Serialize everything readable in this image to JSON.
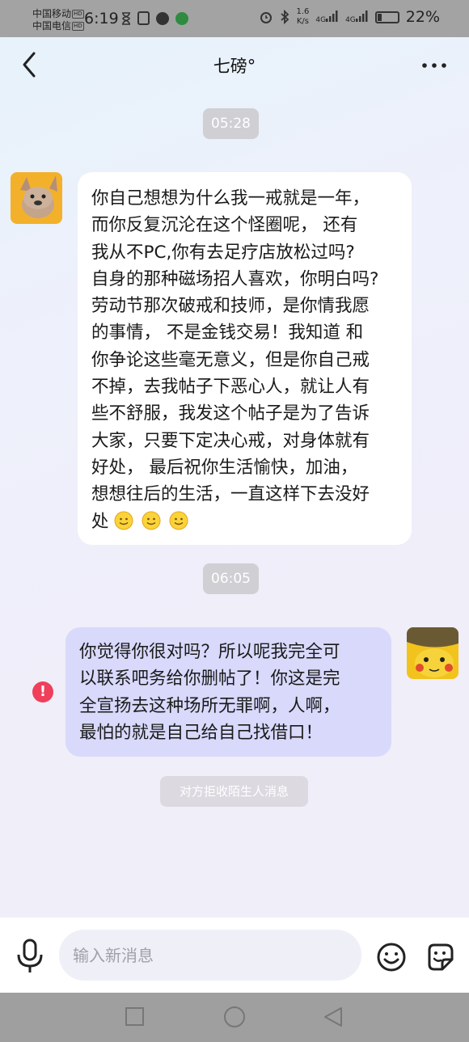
{
  "status_bar": {
    "carrier1": "中国移动",
    "carrier2": "中国电信",
    "hd_badge": "HD",
    "time": "6:19",
    "speed_value": "1.6",
    "speed_unit": "K/s",
    "net_label": "4G",
    "battery_pct": "22%",
    "battery_level": 0.22
  },
  "header": {
    "title": "七磅°"
  },
  "messages": [
    {
      "time_chip": "05:28",
      "side": "left",
      "lines": [
        "你自己想想为什么我一戒就是一年，",
        "而你反复沉沦在这个怪圈呢， 还有",
        "我从不PC,你有去足疗店放松过吗?",
        "自身的那种磁场招人喜欢，你明白吗?",
        "劳动节那次破戒和技师，是你情我愿",
        "的事情， 不是金钱交易！我知道 和",
        "你争论这些毫无意义，但是你自己戒",
        "不掉，去我帖子下恶心人，就让人有",
        "些不舒服，我发这个帖子是为了告诉",
        "大家，只要下定决心戒，对身体就有",
        "好处， 最后祝你生活愉快，加油，",
        "想想往后的生活，一直这样下去没好"
      ],
      "last_line_prefix": "处",
      "emoji_count": 3
    },
    {
      "time_chip": "06:05",
      "side": "right",
      "lines": [
        "你觉得你很对吗？所以呢我完全可",
        "以联系吧务给你删帖了！你这是完",
        "全宣扬去这种场所无罪啊，人啊，",
        "最怕的就是自己给自己找借口！"
      ],
      "status": "failed"
    }
  ],
  "error_mark": "!",
  "system_notice": "对方拒收陌生人消息",
  "input": {
    "placeholder": "输入新消息"
  },
  "colors": {
    "right_bubble": "#d8d9fb",
    "left_bubble": "#ffffff",
    "error": "#ef3f5a"
  }
}
